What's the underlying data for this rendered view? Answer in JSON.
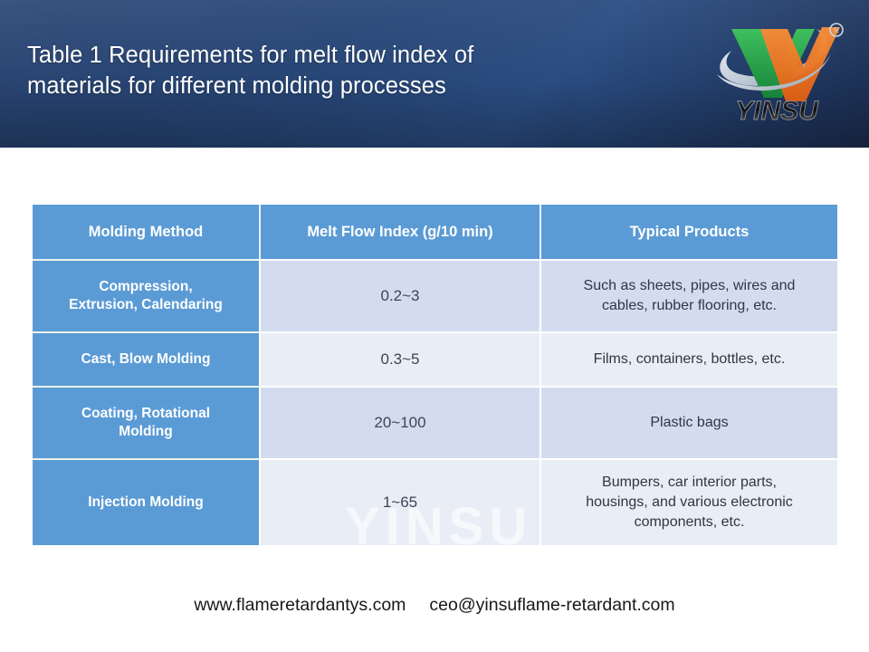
{
  "header": {
    "title": "Table 1 Requirements for melt flow index of\nmaterials for different molding processes",
    "logo_text": "YINSU",
    "logo_trademark": "®"
  },
  "watermark": {
    "text": "YINSU"
  },
  "table": {
    "columns": [
      "Molding Method",
      "Melt Flow Index (g/10 min)",
      "Typical Products"
    ],
    "rows": [
      {
        "method": "Compression,\nExtrusion, Calendaring",
        "mfi": "0.2~3",
        "products": "Such as sheets, pipes, wires and\ncables, rubber flooring, etc."
      },
      {
        "method": "Cast, Blow Molding",
        "mfi": "0.3~5",
        "products": "Films, containers, bottles, etc."
      },
      {
        "method": "Coating, Rotational\nMolding",
        "mfi": "20~100",
        "products": "Plastic bags"
      },
      {
        "method": "Injection Molding",
        "mfi": "1~65",
        "products": "Bumpers, car interior parts,\nhousings, and various electronic\ncomponents, etc."
      }
    ]
  },
  "footer": {
    "website": "www.flameretardantys.com",
    "email": "ceo@yinsuflame-retardant.com"
  },
  "colors": {
    "banner_dark": "#1b2e52",
    "banner_mid": "#2a4d82",
    "table_accent": "#5b9bd5",
    "row_alt_a": "#d3dcef",
    "row_alt_b": "#e9edf6",
    "logo_green": "#2fa84f",
    "logo_orange": "#ee7623"
  }
}
